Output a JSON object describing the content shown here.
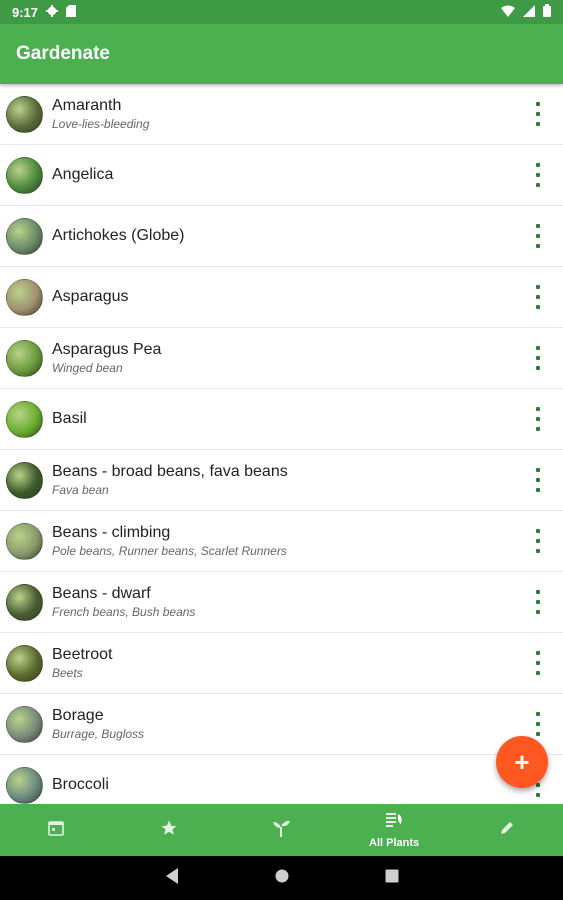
{
  "status_bar": {
    "time": "9:17",
    "icons_left": [
      "gear-icon",
      "sd-card-icon"
    ],
    "icons_right": [
      "wifi-icon",
      "signal-icon",
      "battery-icon"
    ]
  },
  "app_bar": {
    "title": "Gardenate"
  },
  "plants": [
    {
      "name": "Amaranth",
      "subtitle": "Love-lies-bleeding",
      "color": "#5b6b3a"
    },
    {
      "name": "Angelica",
      "subtitle": "",
      "color": "#4d8a3c"
    },
    {
      "name": "Artichokes (Globe)",
      "subtitle": "",
      "color": "#6b8a6a"
    },
    {
      "name": "Asparagus",
      "subtitle": "",
      "color": "#a09070"
    },
    {
      "name": "Asparagus Pea",
      "subtitle": "Winged bean",
      "color": "#6c9a3e"
    },
    {
      "name": "Basil",
      "subtitle": "",
      "color": "#6aae2e"
    },
    {
      "name": "Beans - broad beans, fava beans",
      "subtitle": "Fava bean",
      "color": "#3e5a2c"
    },
    {
      "name": "Beans - climbing",
      "subtitle": "Pole beans, Runner beans, Scarlet Runners",
      "color": "#8a9a6a"
    },
    {
      "name": "Beans - dwarf",
      "subtitle": "French beans, Bush beans",
      "color": "#4a5c34"
    },
    {
      "name": "Beetroot",
      "subtitle": "Beets",
      "color": "#5a6a2e"
    },
    {
      "name": "Borage",
      "subtitle": "Burrage, Bugloss",
      "color": "#7a8a7a"
    },
    {
      "name": "Broccoli",
      "subtitle": "",
      "color": "#6a8a80"
    }
  ],
  "fab": {
    "label": "+"
  },
  "bottom_nav": [
    {
      "icon": "calendar-icon",
      "label": ""
    },
    {
      "icon": "star-icon",
      "label": ""
    },
    {
      "icon": "sprout-icon",
      "label": ""
    },
    {
      "icon": "notes-icon",
      "label": "All Plants"
    },
    {
      "icon": "pencil-icon",
      "label": ""
    }
  ],
  "system_nav": [
    "back-icon",
    "home-icon",
    "recents-icon"
  ],
  "colors": {
    "primary": "#4caf50",
    "status_bar": "#3f9a46",
    "accent": "#ff5722",
    "menu_dots": "#2e7d32"
  }
}
